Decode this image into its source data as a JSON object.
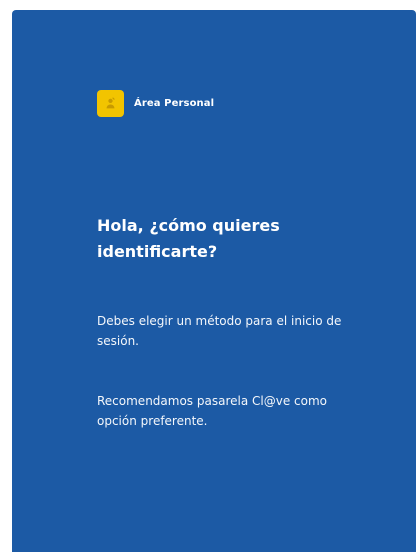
{
  "brand": {
    "icon": "user-badge-icon",
    "label": "Área Personal"
  },
  "login": {
    "heading": "Hola, ¿cómo quieres identificarte?",
    "paragraph1": "Debes elegir un método para el inicio de sesión.",
    "paragraph2": "Recomendamos pasarela Cl@ve como opción preferente."
  },
  "colors": {
    "panel_background": "#1c5aa5",
    "accent": "#f2c400",
    "text": "#ffffff"
  }
}
